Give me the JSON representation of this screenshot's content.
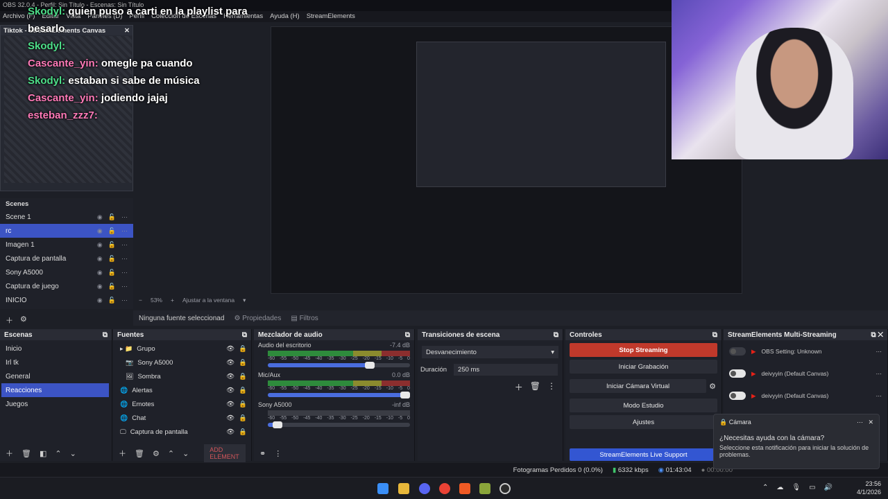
{
  "app": {
    "title": "OBS 32.0.4 - Perfil: Sin Título - Escenas: Sin Título"
  },
  "menu": [
    "Archivo (F)",
    "Editar",
    "Vista",
    "Paneles (D)",
    "Perfil",
    "Colección de Escenas",
    "Herramientas",
    "Ayuda (H)",
    "StreamElements"
  ],
  "chat": [
    {
      "user": "Skodyl:",
      "msg": "quien puso a carti en la playlist para besarlo",
      "green": true
    },
    {
      "user": "Skodyl:",
      "msg": "",
      "green": true
    },
    {
      "user": "Cascante_yin:",
      "msg": "omegle pa cuando",
      "green": false
    },
    {
      "user": "Skodyl:",
      "msg": "estaban si sabe de música",
      "green": true
    },
    {
      "user": "Cascante_yin:",
      "msg": "jodiendo jajaj",
      "green": false
    },
    {
      "user": "esteban_zzz7:",
      "msg": "",
      "green": false
    }
  ],
  "canvas_dock": {
    "title": "Tiktok - StreamElements Canvas"
  },
  "left_scenes": {
    "title": "Scenes",
    "items": [
      {
        "label": "Scene 1",
        "sel": false
      },
      {
        "label": "rc",
        "sel": true
      },
      {
        "label": "Imagen 1",
        "sel": false
      },
      {
        "label": "Captura de pantalla",
        "sel": false
      },
      {
        "label": "Sony A5000",
        "sel": false
      },
      {
        "label": "Captura de juego",
        "sel": false
      },
      {
        "label": "INICIO",
        "sel": false
      }
    ]
  },
  "zoom": {
    "value": "53%",
    "mode": "Ajustar a la ventana"
  },
  "props": {
    "none": "Ninguna fuente seleccionad",
    "properties": "Propiedades",
    "filters": "Filtros"
  },
  "escenas": {
    "title": "Escenas",
    "items": [
      "Inicio",
      "Irl tk",
      "General",
      "Reacciones",
      "Juegos"
    ],
    "selected": 3
  },
  "fuentes": {
    "title": "Fuentes",
    "items": [
      {
        "label": "Grupo",
        "icon": "folder-icon"
      },
      {
        "label": "Sony A5000",
        "icon": "camera-icon"
      },
      {
        "label": "Sombra",
        "icon": "image-icon"
      },
      {
        "label": "Alertas",
        "icon": "browser-icon"
      },
      {
        "label": "Emotes",
        "icon": "browser-icon"
      },
      {
        "label": "Chat",
        "icon": "browser-icon"
      },
      {
        "label": "Captura de pantalla",
        "icon": "monitor-icon"
      }
    ],
    "add_element": "ADD ELEMENT"
  },
  "mixer": {
    "title": "Mezclador de audio",
    "scale": [
      "-60",
      "-55",
      "-50",
      "-45",
      "-40",
      "-35",
      "-30",
      "-25",
      "-20",
      "-15",
      "-10",
      "-5",
      "0"
    ],
    "channels": [
      {
        "name": "Audio del escritorio",
        "db": "-7.4 dB",
        "level": 0.55,
        "volume": 0.75,
        "active": true
      },
      {
        "name": "Mic/Aux",
        "db": "0.0 dB",
        "level": 0.35,
        "volume": 1.0,
        "active": true
      },
      {
        "name": "Sony A5000",
        "db": "-inf dB",
        "level": 0.0,
        "volume": 0.1,
        "active": false
      }
    ]
  },
  "transitions": {
    "title": "Transiciones de escena",
    "selected": "Desvanecimiento",
    "duration_label": "Duración",
    "duration": "250 ms"
  },
  "controls": {
    "title": "Controles",
    "stop": "Stop Streaming",
    "record": "Iniciar Grabación",
    "vcam": "Iniciar Cámara Virtual",
    "studio": "Modo Estudio",
    "settings": "Ajustes",
    "support": "StreamElements Live Support"
  },
  "multistream": {
    "title": "StreamElements Multi-Streaming",
    "rows": [
      {
        "label": "OBS Setting: Unknown",
        "on": false
      },
      {
        "label": "deivyyin (Default Canvas)",
        "on": true
      },
      {
        "label": "deivyyin (Default Canvas)",
        "on": true
      }
    ]
  },
  "notification": {
    "app": "Cámara",
    "title": "¿Necesitas ayuda con la cámara?",
    "body": "Seleccione esta notificación para iniciar la solución de problemas."
  },
  "status": {
    "dropped": "Fotogramas Perdidos 0 (0.0%)",
    "bitrate": "6332 kbps",
    "live_time": "01:43:04",
    "rec_time": "00:00:00"
  },
  "clock": {
    "time": "23:56",
    "date": "4/1/2026"
  },
  "colors": {
    "accent": "#3c54c4",
    "stop": "#c0392b"
  }
}
